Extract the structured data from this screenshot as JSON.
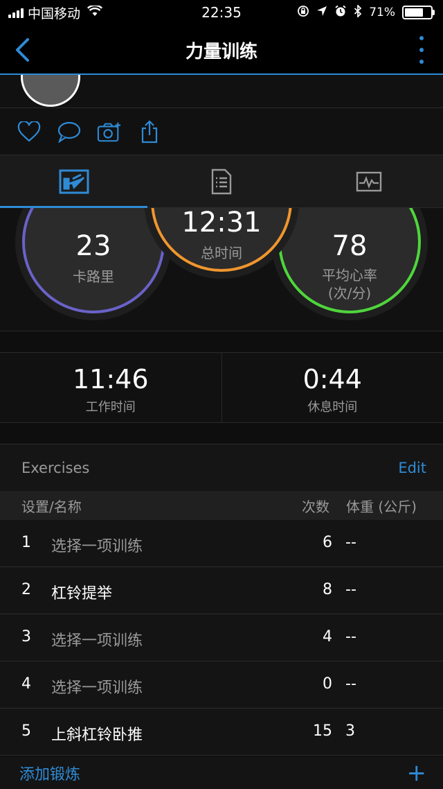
{
  "status_bar": {
    "carrier": "中国移动",
    "time": "22:35",
    "battery": "71%",
    "battery_level": 0.71
  },
  "nav": {
    "title": "力量训练"
  },
  "tabs": [
    {
      "name": "summary",
      "icon": "chart-icon",
      "active": true
    },
    {
      "name": "details",
      "icon": "list-document-icon",
      "active": false
    },
    {
      "name": "graph",
      "icon": "heart-rate-chart-icon",
      "active": false
    }
  ],
  "rings": {
    "calories": {
      "value": "23",
      "label": "卡路里"
    },
    "total_time": {
      "value": "12:31",
      "label": "总时间"
    },
    "heart_rate": {
      "value": "78",
      "label_line1": "平均心率",
      "label_line2": "(次/分)"
    }
  },
  "work_rest": {
    "work": {
      "value": "11:46",
      "label": "工作时间"
    },
    "rest": {
      "value": "0:44",
      "label": "休息时间"
    }
  },
  "exercises": {
    "title": "Exercises",
    "edit_label": "Edit",
    "columns": {
      "name": "设置/名称",
      "reps": "次数",
      "weight": "体重 (公斤)"
    },
    "rows": [
      {
        "num": "1",
        "name": "选择一项训练",
        "reps": "6",
        "weight": "--",
        "placeholder": true
      },
      {
        "num": "2",
        "name": "杠铃提举",
        "reps": "8",
        "weight": "--",
        "placeholder": false
      },
      {
        "num": "3",
        "name": "选择一项训练",
        "reps": "4",
        "weight": "--",
        "placeholder": true
      },
      {
        "num": "4",
        "name": "选择一项训练",
        "reps": "0",
        "weight": "--",
        "placeholder": true
      },
      {
        "num": "5",
        "name": "上斜杠铃卧推",
        "reps": "15",
        "weight": "3",
        "placeholder": false
      }
    ],
    "add_label": "添加锻炼",
    "add_symbol": "+"
  },
  "colors": {
    "accent": "#2f8bd6",
    "calories_ring": "#6a62c8",
    "time_ring": "#f0962e",
    "heart_ring": "#4fd63c"
  }
}
